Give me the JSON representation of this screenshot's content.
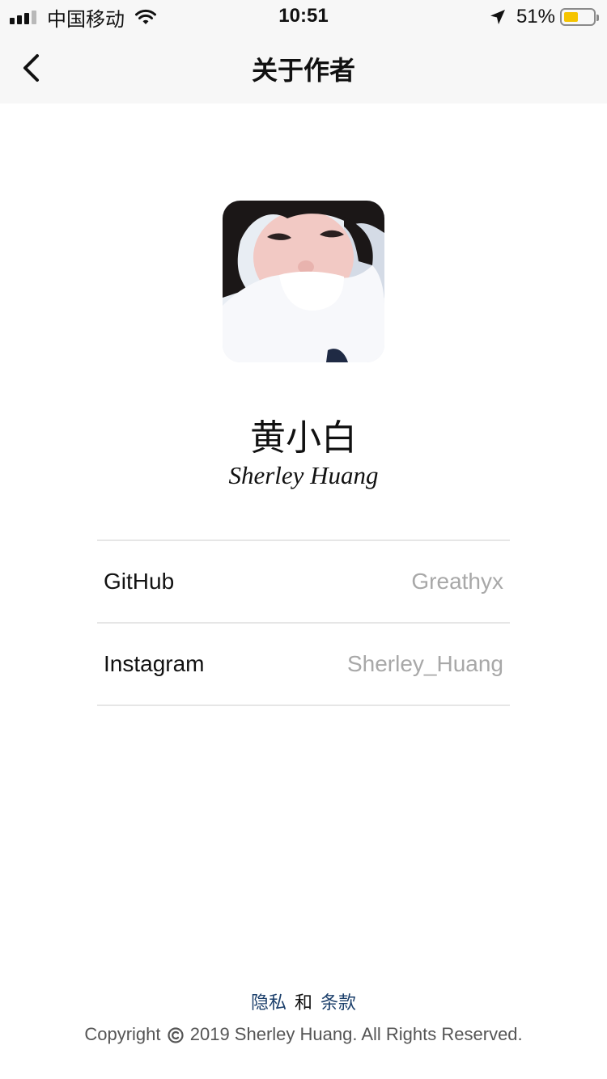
{
  "status_bar": {
    "carrier": "中国移动",
    "time": "10:51",
    "battery_percent": "51%",
    "battery_level": 0.51,
    "battery_color": "#f5c400",
    "signal_bars_active": 3,
    "signal_bars_total": 4,
    "icons": [
      "signal-icon",
      "wifi-icon",
      "location-arrow-icon",
      "battery-icon"
    ]
  },
  "nav": {
    "title": "关于作者",
    "back_icon": "chevron-left-icon"
  },
  "profile": {
    "name_cn": "黄小白",
    "name_en": "Sherley Huang"
  },
  "links": [
    {
      "label": "GitHub",
      "value": "Greathyx"
    },
    {
      "label": "Instagram",
      "value": "Sherley_Huang"
    }
  ],
  "footer": {
    "privacy_label": "隐私",
    "and_label": "和",
    "terms_label": "条款",
    "copyright_prefix": "Copyright",
    "copyright_suffix": "2019 Sherley Huang. All Rights Reserved.",
    "link_color": "#1b3f6b"
  }
}
